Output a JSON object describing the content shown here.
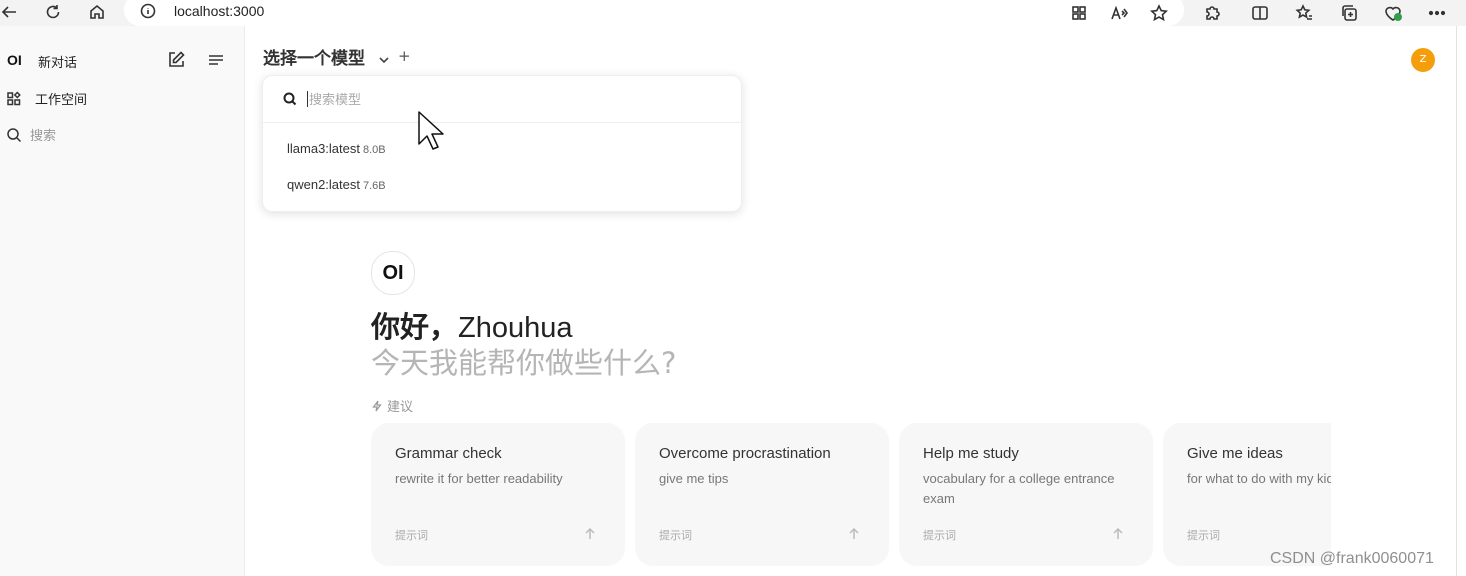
{
  "browser": {
    "url": "localhost:3000"
  },
  "sidebar": {
    "logo": "OI",
    "new_chat": "新对话",
    "workspace": "工作空间",
    "search": "搜索"
  },
  "topbar": {
    "model_select_title": "选择一个模型",
    "add_label": "+",
    "avatar_initial": "Z"
  },
  "model_dropdown": {
    "search_placeholder": "搜索模型",
    "items": [
      {
        "name": "llama3:latest",
        "size": "8.0B"
      },
      {
        "name": "qwen2:latest",
        "size": "7.6B"
      }
    ]
  },
  "main": {
    "logo": "OI",
    "greeting_prefix": "你好，",
    "user_name": "Zhouhua",
    "subtitle": "今天我能帮你做些什么?",
    "suggestion_label": "建议",
    "cards": [
      {
        "title": "Grammar check",
        "desc": "rewrite it for better readability",
        "prompt": "提示词"
      },
      {
        "title": "Overcome procrastination",
        "desc": "give me tips",
        "prompt": "提示词"
      },
      {
        "title": "Help me study",
        "desc": "vocabulary for a college entrance exam",
        "prompt": "提示词"
      },
      {
        "title": "Give me ideas",
        "desc": "for what to do with my kids' art",
        "prompt": "提示词"
      }
    ]
  },
  "watermark": "CSDN @frank0060071",
  "colors": {
    "avatar": "#f59e0b",
    "sidebar_bg": "#f9f9f9",
    "card_bg": "#f7f7f7"
  }
}
